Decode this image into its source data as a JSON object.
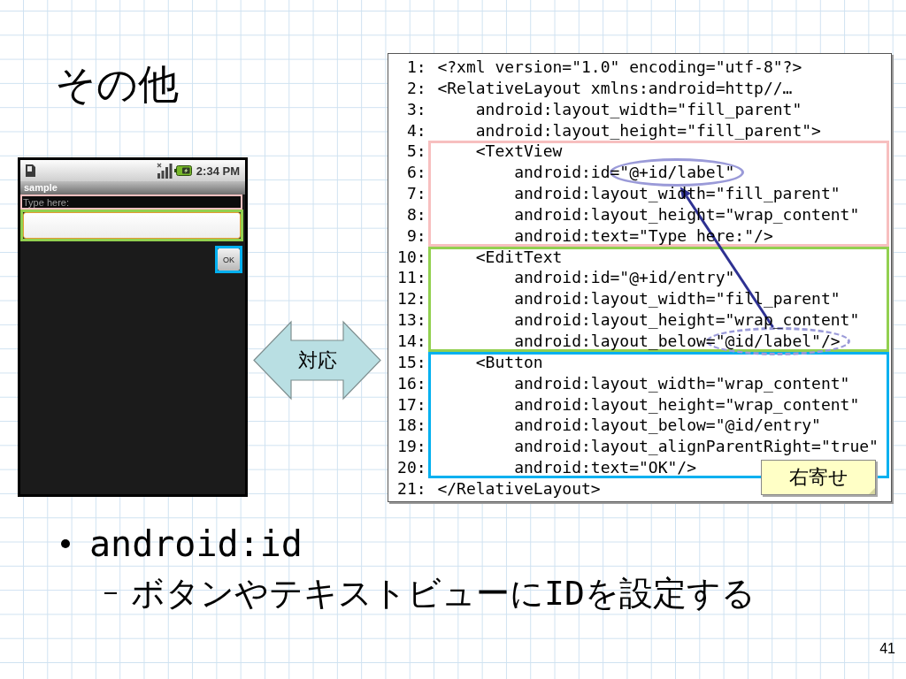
{
  "title": "その他",
  "phone": {
    "status_time": "2:34 PM",
    "app_title": "sample",
    "widgets": [
      {
        "kind": "label",
        "text": "Type here:",
        "color": "#f7bfbf"
      },
      {
        "kind": "field",
        "color": "#92d050"
      },
      {
        "kind": "button",
        "text": "OK",
        "color": "#00b0f0"
      }
    ]
  },
  "mapping_arrow": {
    "label": "対応"
  },
  "code": {
    "lines": [
      {
        "number": "1:",
        "text": "<?xml version=\"1.0\" encoding=\"utf-8\"?>"
      },
      {
        "number": "2:",
        "text": "<RelativeLayout xmlns:android=http//…",
        "children": [
          {
            "number": "3:",
            "text": "android:layout_width=\"fill_parent\""
          },
          {
            "number": "4:",
            "text": "android:layout_height=\"fill_parent\">"
          },
          {
            "number": "5:",
            "text": "<TextView",
            "color": "#f7bfbf",
            "children": [
              {
                "number": "6:",
                "text": "android:id=",
                "mark": {
                  "text": "\"@+id/label\"",
                  "dashed": false
                }
              },
              {
                "number": "7:",
                "text": "android:layout_width=\"fill_parent\""
              },
              {
                "number": "8:",
                "text": "android:layout_height=\"wrap_content\""
              },
              {
                "number": "9:",
                "text": "android:text=\"Type here:\"/>"
              }
            ]
          },
          {
            "number": "10:",
            "text": "<EditText",
            "color": "#92d050",
            "children": [
              {
                "number": "11:",
                "text": "android:id=\"@+id/entry\""
              },
              {
                "number": "12:",
                "text": "android:layout_width=\"fill_parent\""
              },
              {
                "number": "13:",
                "text": "android:layout_height=\"wrap_content\""
              },
              {
                "number": "14:",
                "text": "android:layout_below=",
                "mark": {
                  "text": "\"@id/label\"/>",
                  "dashed": true
                }
              }
            ]
          },
          {
            "number": "15:",
            "text": "<Button",
            "color": "#00b0f0",
            "children": [
              {
                "number": "16:",
                "text": "android:layout_width=\"wrap_content\""
              },
              {
                "number": "17:",
                "text": "android:layout_height=\"wrap_content\""
              },
              {
                "number": "18:",
                "text": "android:layout_below=\"@id/entry\""
              },
              {
                "number": "19:",
                "text": "android:layout_alignParentRight=\"true\""
              },
              {
                "number": "20:",
                "text": "android:text=\"OK\"/>"
              }
            ]
          }
        ]
      },
      {
        "number": "21:",
        "text": "</RelativeLayout>"
      }
    ],
    "callout": "右寄せ"
  },
  "bullets": [
    {
      "text": "android:id",
      "children": [
        {
          "text": "ボタンやテキストビューにIDを設定する"
        }
      ]
    }
  ],
  "page_number": "41"
}
